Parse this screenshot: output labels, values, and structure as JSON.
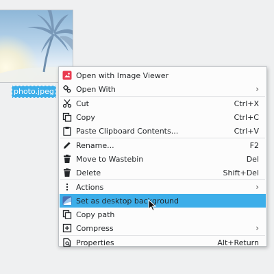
{
  "file": {
    "name": "photo.jpeg"
  },
  "menu": {
    "groups": [
      [
        {
          "label": "Open with Image Viewer",
          "icon": "image-viewer-icon",
          "shortcut": "",
          "submenu": false
        },
        {
          "label": "Open With",
          "icon": "open-with-icon",
          "shortcut": "",
          "submenu": true
        }
      ],
      [
        {
          "label": "Cut",
          "icon": "scissors-icon",
          "shortcut": "Ctrl+X",
          "submenu": false
        },
        {
          "label": "Copy",
          "icon": "copy-icon",
          "shortcut": "Ctrl+C",
          "submenu": false
        },
        {
          "label": "Paste Clipboard Contents...",
          "icon": "clipboard-icon",
          "shortcut": "Ctrl+V",
          "submenu": false
        }
      ],
      [
        {
          "label": "Rename...",
          "icon": "pencil-icon",
          "shortcut": "F2",
          "submenu": false
        },
        {
          "label": "Move to Wastebin",
          "icon": "trash-icon",
          "shortcut": "Del",
          "submenu": false
        },
        {
          "label": "Delete",
          "icon": "trash-icon",
          "shortcut": "Shift+Del",
          "submenu": false
        }
      ],
      [
        {
          "label": "Actions",
          "icon": "more-vertical-icon",
          "shortcut": "",
          "submenu": true
        },
        {
          "label": "Set as desktop background",
          "icon": "wallpaper-icon",
          "shortcut": "",
          "submenu": false,
          "highlighted": true
        },
        {
          "label": "Copy path",
          "icon": "copy-icon",
          "shortcut": "",
          "submenu": false
        },
        {
          "label": "Compress",
          "icon": "archive-icon",
          "shortcut": "",
          "submenu": true
        }
      ],
      [
        {
          "label": "Properties",
          "icon": "properties-icon",
          "shortcut": "Alt+Return",
          "submenu": false
        }
      ]
    ]
  },
  "colors": {
    "highlight": "#3daee9",
    "menu_bg": "#fcfcfc",
    "desktop_bg": "#eff0f1"
  }
}
